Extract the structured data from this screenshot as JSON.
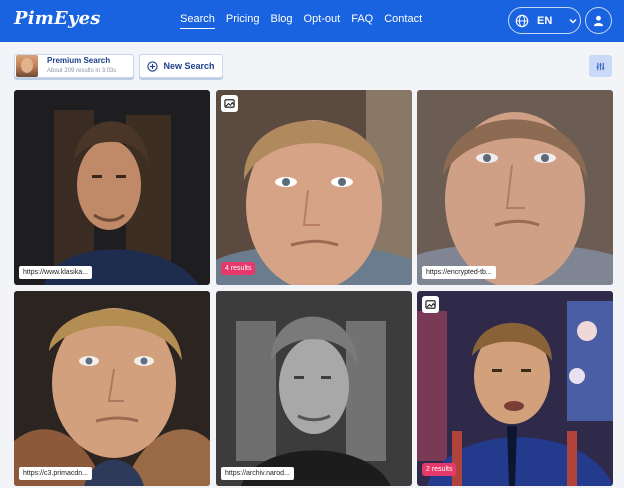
{
  "header": {
    "logo": "PimEyes",
    "nav": [
      "Search",
      "Pricing",
      "Blog",
      "Opt-out",
      "FAQ",
      "Contact"
    ],
    "active_nav": "Search",
    "language": "EN"
  },
  "toolbar": {
    "premium_title": "Premium Search",
    "premium_subtitle": "About 209 results in 3.03s",
    "new_search_label": "New Search"
  },
  "results": [
    {
      "url": "https://www.klasika...",
      "count": "",
      "has_image_badge": false
    },
    {
      "url": "",
      "count": "4 results",
      "has_image_badge": true
    },
    {
      "url": "https://encrypted-tb...",
      "count": "",
      "has_image_badge": false
    },
    {
      "url": "https://c3.primacdn...",
      "count": "",
      "has_image_badge": false
    },
    {
      "url": "https://archiv.narod...",
      "count": "",
      "has_image_badge": false
    },
    {
      "url": "",
      "count": "2 results",
      "has_image_badge": true
    }
  ],
  "colors": {
    "header_bg": "#1a63e0",
    "accent": "#1b3f8b",
    "count_badge": "#e5386b",
    "page_bg": "#f2f4f8"
  },
  "icons": [
    "globe-icon",
    "chevron-down-icon",
    "user-icon",
    "plus-circle-icon",
    "filter-sliders-icon",
    "image-badge-icon"
  ]
}
